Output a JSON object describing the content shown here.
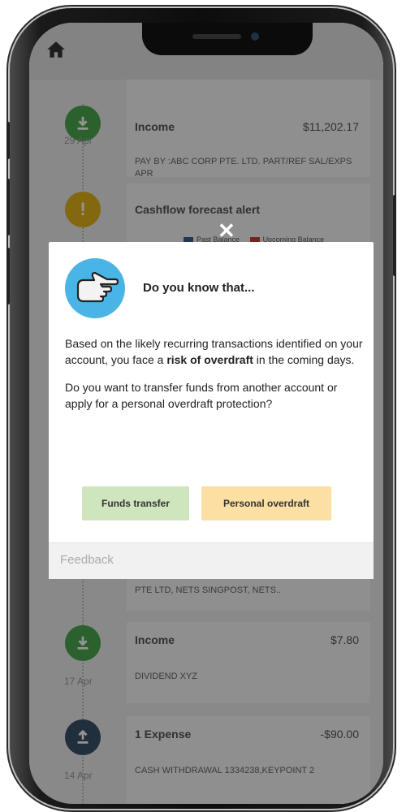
{
  "timeline": [
    {
      "kind": "income",
      "title": "Income",
      "amount": "$11,202.17",
      "date": "29 Apr",
      "desc": "PAY BY :ABC CORP PTE. LTD. PART/REF SAL/EXPS APR",
      "color": "#4ba84f",
      "icon": "download-icon"
    },
    {
      "kind": "alert",
      "title": "Cashflow forecast alert",
      "amount": "",
      "date": "",
      "desc": "",
      "color": "#e2b31a",
      "icon": "exclamation-icon"
    },
    {
      "kind": "expense-partial",
      "title": "",
      "amount": "",
      "date": "",
      "desc": "PTE LTD, NETS SINGPOST, NETS..",
      "color": "",
      "icon": ""
    },
    {
      "kind": "income",
      "title": "Income",
      "amount": "$7.80",
      "date": "17 Apr",
      "desc": "DIVIDEND XYZ",
      "color": "#4ba84f",
      "icon": "download-icon"
    },
    {
      "kind": "expense",
      "title": "1 Expense",
      "amount": "-$90.00",
      "date": "14 Apr",
      "desc": "CASH WITHDRAWAL 1334238,KEYPOINT 2",
      "color": "#3a5068",
      "icon": "upload-icon"
    }
  ],
  "legend": {
    "past_label": "Past Balance",
    "past_color": "#3c5f94",
    "upcoming_label": "Upcoming Balance",
    "upcoming_color": "#c9403a"
  },
  "modal": {
    "close_glyph": "✕",
    "title": "Do you know that...",
    "para1_pre": "Based on the likely recurring transactions identified on your account, you face a ",
    "para1_bold": "risk of overdraft",
    "para1_post": " in the coming days.",
    "para2": "Do you want to transfer funds from another account or apply for a personal overdraft protection?",
    "btn_transfer": "Funds transfer",
    "btn_overdraft": "Personal overdraft",
    "feedback_label": "Feedback",
    "icon": "pointing-hand-icon"
  },
  "colors": {
    "income": "#4ba84f",
    "alert": "#e2b31a",
    "expense": "#3a5068",
    "modal_icon_bg": "#4ab4e6"
  }
}
